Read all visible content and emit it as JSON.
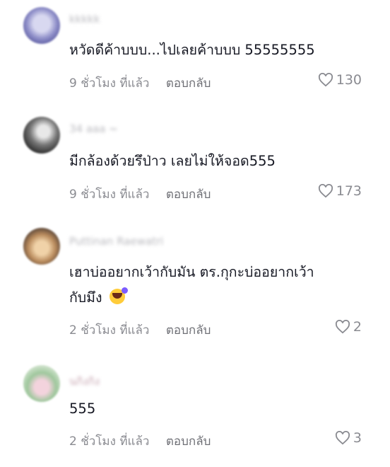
{
  "comments": [
    {
      "username": "kkkkk",
      "text": "หวัดดีค้าบบบ...ไปเลยค้าบบบ 55555555",
      "time": "9 ชั่วโมง ที่แล้ว",
      "reply": "ตอบกลับ",
      "likes": "130"
    },
    {
      "username": "34 aaa",
      "username_suffix": "~",
      "text": "มีกล้องด้วยรึป่าว เลยไม่ให้จอด555",
      "time": "9 ชั่วโมง ที่แล้ว",
      "reply": "ตอบกลับ",
      "likes": "173"
    },
    {
      "username": "Puttinan Raewatri",
      "text_line1": "เฮาบ่ออยากเว้ากับมัน ตร.กุกะบ่ออยากเว้า",
      "text_line2": "กับมึง",
      "emoji": "rolling-on-floor-laughing",
      "time": "2 ชั่วโมง ที่แล้ว",
      "reply": "ตอบกลับ",
      "likes": "2"
    },
    {
      "username": "นกิงกิง",
      "text": "555",
      "time": "2 ชั่วโมง ที่แล้ว",
      "reply": "ตอบกลับ",
      "likes": "3"
    }
  ],
  "colors": {
    "text": "#161823",
    "meta": "#8a8b91",
    "background": "#ffffff"
  },
  "icons": {
    "like": "heart-outline-icon"
  }
}
